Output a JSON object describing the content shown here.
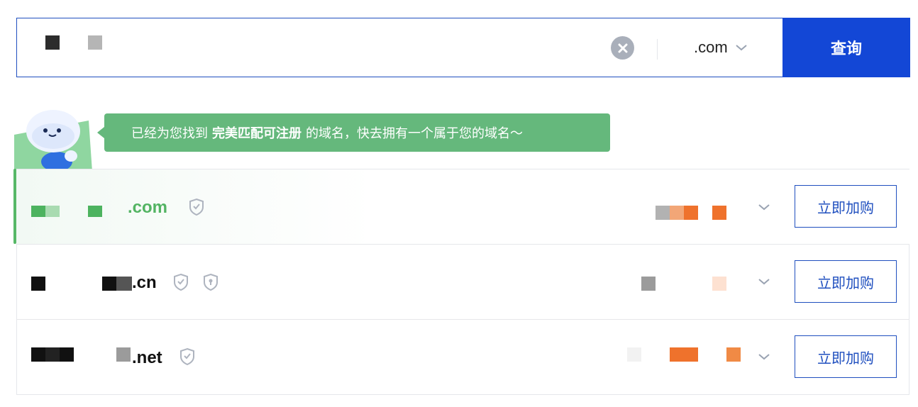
{
  "search": {
    "placeholder": "",
    "suffix": ".com",
    "button_label": "查询"
  },
  "tip": {
    "prefix": "已经为您找到",
    "highlight": "完美匹配可注册",
    "suffix": "的域名，快去拥有一个属于您的域名～"
  },
  "results": [
    {
      "suffix": ".com",
      "buy_label": "立即加购",
      "suffix_color": "#53b463"
    },
    {
      "suffix": ".cn",
      "buy_label": "立即加购",
      "suffix_color": "#111111"
    },
    {
      "suffix": ".net",
      "buy_label": "立即加购",
      "suffix_color": "#111111"
    }
  ],
  "colors": {
    "primary": "#1347d6",
    "accent_green": "#57b867",
    "price_orange": "#f07a2c"
  }
}
